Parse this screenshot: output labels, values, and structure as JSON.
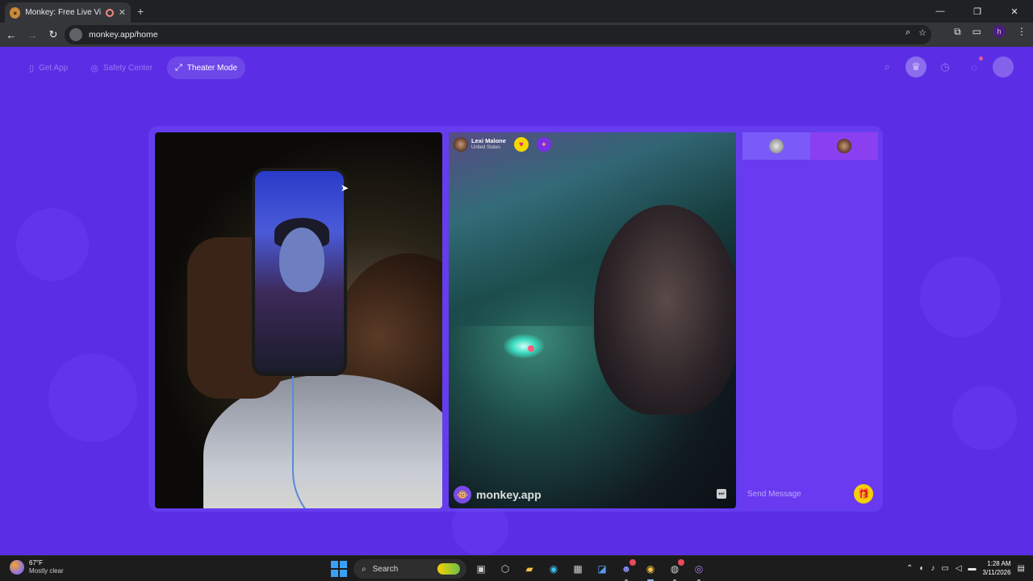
{
  "browser": {
    "tab_title": "Monkey: Free Live Video Ch",
    "url": "monkey.app/home"
  },
  "topnav": {
    "get_app": "Get App",
    "safety_center": "Safety Center",
    "theater_mode": "Theater Mode"
  },
  "peer": {
    "name": "Lexi Malone",
    "location": "United States"
  },
  "watermark": "monkey.app",
  "chat": {
    "placeholder": "Send Message"
  },
  "taskbar": {
    "temperature": "67°F",
    "weather": "Mostly clear",
    "search_label": "Search",
    "time": "1:28 AM",
    "date": "3/11/2026"
  },
  "colors": {
    "page_bg": "#5b2ee6",
    "chat_panel": "#6a3af0",
    "gift_button": "#f5d000"
  },
  "icons": {
    "topnav": [
      "phone-icon",
      "shield-icon",
      "expand-icon"
    ],
    "header_right": [
      "search-icon",
      "crown-icon",
      "history-icon",
      "chat-bubble-icon",
      "avatar"
    ],
    "peer_actions": [
      "heart-icon",
      "report-icon"
    ]
  }
}
